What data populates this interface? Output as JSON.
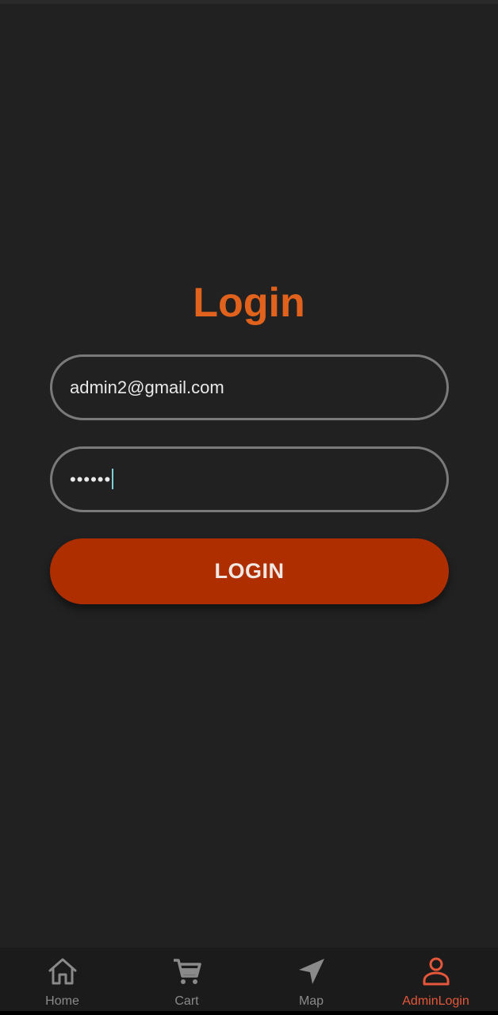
{
  "login": {
    "title": "Login",
    "email_value": "admin2@gmail.com",
    "password_value": "••••••",
    "button_label": "LOGIN"
  },
  "nav": {
    "items": [
      {
        "label": "Home",
        "icon": "home-icon",
        "active": false
      },
      {
        "label": "Cart",
        "icon": "cart-icon",
        "active": false
      },
      {
        "label": "Map",
        "icon": "navigation-icon",
        "active": false
      },
      {
        "label": "AdminLogin",
        "icon": "person-icon",
        "active": true
      }
    ]
  },
  "colors": {
    "background": "#212121",
    "title": "#e0621c",
    "button": "#ae2e00",
    "field_border": "#7a7a7a",
    "nav_active": "#e5573a",
    "nav_inactive": "#8a8a8a",
    "caret": "#7fd0d6"
  }
}
